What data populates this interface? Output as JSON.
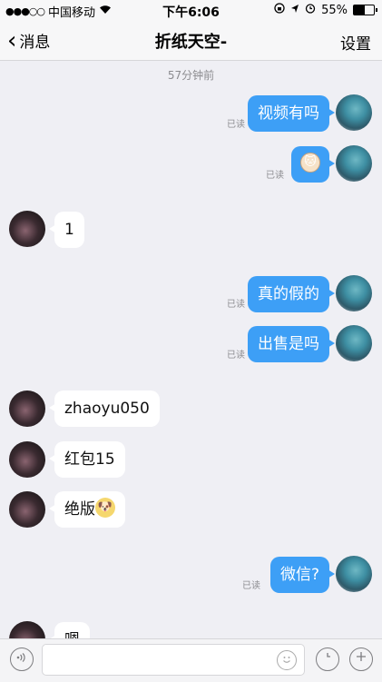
{
  "status_bar": {
    "signal": "●●●○○",
    "carrier": "中国移动",
    "wifi_icon": "wifi-icon",
    "time": "下午6:06",
    "battery": "55%",
    "battery_level": 0.55
  },
  "nav": {
    "back_label": "消息",
    "title": "折纸天空-",
    "settings_label": "设置"
  },
  "timestamp": "57分钟前",
  "read_label": "已读",
  "messages": [
    {
      "side": "out",
      "text": "视频有吗",
      "read": "已读"
    },
    {
      "side": "out",
      "text": "",
      "emoji": "cat-emoji",
      "read": "已读"
    },
    {
      "side": "in",
      "text": "1"
    },
    {
      "side": "out",
      "text": "真的假的",
      "read": "已读"
    },
    {
      "side": "out",
      "text": "出售是吗",
      "read": "已读"
    },
    {
      "side": "in",
      "text": "zhaoyu050"
    },
    {
      "side": "in",
      "text": "红包15"
    },
    {
      "side": "in",
      "text": "绝版",
      "emoji": "doge-emoji"
    },
    {
      "side": "out",
      "text": "微信?",
      "read": "已读"
    },
    {
      "side": "in",
      "text": "嗯"
    }
  ],
  "input": {
    "voice_icon": "voice-icon",
    "emoji_icon": "smile-icon",
    "clock_icon": "clock-icon",
    "plus_icon": "plus-icon"
  },
  "colors": {
    "outgoing_bubble": "#3d9ff6",
    "incoming_bubble": "#ffffff",
    "background": "#efeff4"
  }
}
